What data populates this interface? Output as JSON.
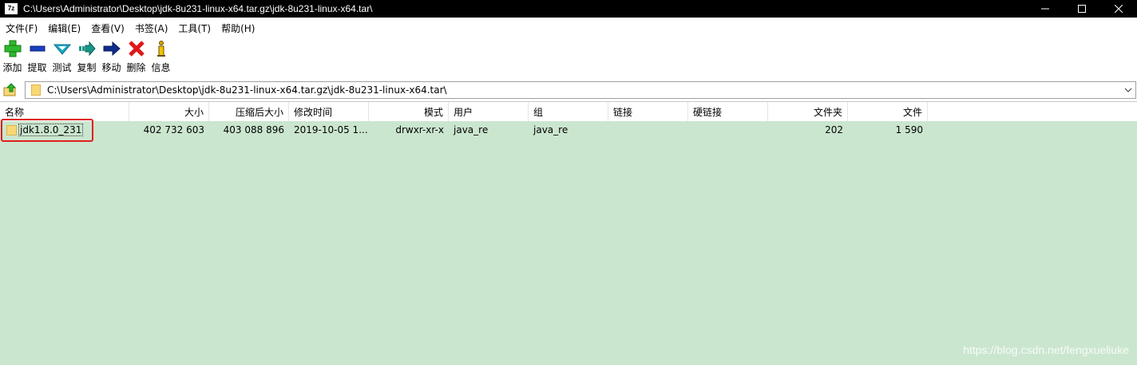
{
  "window": {
    "app_icon_text": "7z",
    "title": "C:\\Users\\Administrator\\Desktop\\jdk-8u231-linux-x64.tar.gz\\jdk-8u231-linux-x64.tar\\"
  },
  "menu": [
    {
      "label": "文件(F)"
    },
    {
      "label": "编辑(E)"
    },
    {
      "label": "查看(V)"
    },
    {
      "label": "书签(A)"
    },
    {
      "label": "工具(T)"
    },
    {
      "label": "帮助(H)"
    }
  ],
  "toolbar": [
    {
      "label": "添加",
      "icon": "add-icon",
      "color": "#2eb82e"
    },
    {
      "label": "提取",
      "icon": "extract-icon",
      "color": "#1a3fbf"
    },
    {
      "label": "测试",
      "icon": "test-icon",
      "color": "#17a8c8"
    },
    {
      "label": "复制",
      "icon": "copy-icon",
      "color": "#18968a"
    },
    {
      "label": "移动",
      "icon": "move-icon",
      "color": "#0f2c8c"
    },
    {
      "label": "删除",
      "icon": "delete-icon",
      "color": "#e01818"
    },
    {
      "label": "信息",
      "icon": "info-icon",
      "color": "#d9a400"
    }
  ],
  "address": {
    "path": "C:\\Users\\Administrator\\Desktop\\jdk-8u231-linux-x64.tar.gz\\jdk-8u231-linux-x64.tar\\"
  },
  "columns": [
    {
      "label": "名称"
    },
    {
      "label": "大小"
    },
    {
      "label": "压缩后大小"
    },
    {
      "label": "修改时间"
    },
    {
      "label": "模式"
    },
    {
      "label": "用户"
    },
    {
      "label": "组"
    },
    {
      "label": "链接"
    },
    {
      "label": "硬链接"
    },
    {
      "label": "文件夹"
    },
    {
      "label": "文件"
    }
  ],
  "rows": [
    {
      "name": "jdk1.8.0_231",
      "size": "402 732 603",
      "packed_size": "403 088 896",
      "modified": "2019-10-05 1...",
      "mode": "drwxr-xr-x",
      "user": "java_re",
      "group": "java_re",
      "link": "",
      "hardlink": "",
      "folders": "202",
      "files": "1 590"
    }
  ],
  "watermark": "https://blog.csdn.net/fengxueliuke",
  "colors": {
    "list_background": "#cbe6cf",
    "highlight": "#e02020",
    "titlebar": "#000000"
  }
}
